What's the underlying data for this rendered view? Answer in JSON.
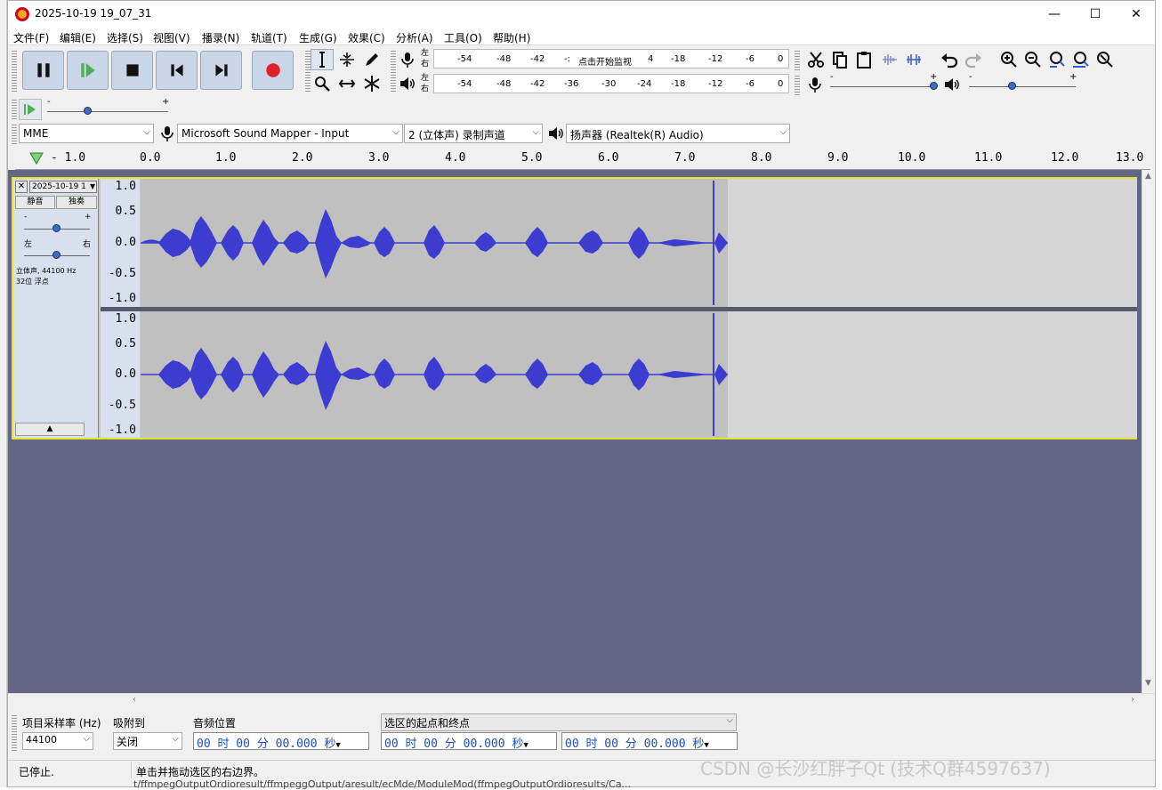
{
  "window": {
    "title": "2025-10-19 19_07_31",
    "minimize_glyph": "—",
    "maximize_glyph": "☐",
    "close_glyph": "✕"
  },
  "menu": [
    "文件(F)",
    "编辑(E)",
    "选择(S)",
    "视图(V)",
    "播录(N)",
    "轨道(T)",
    "生成(G)",
    "效果(C)",
    "分析(A)",
    "工具(O)",
    "帮助(H)"
  ],
  "transport": {
    "buttons": [
      "pause-icon",
      "play-icon",
      "stop-icon",
      "skip-start-icon",
      "skip-end-icon",
      "record-icon"
    ],
    "record_color": "#e0202a"
  },
  "meters": {
    "record_lr": [
      "左",
      "右"
    ],
    "record_ticks": [
      "-54",
      "-48",
      "-42",
      "-:",
      "-18",
      "-12",
      "-6",
      "0"
    ],
    "record_prompt": "点击开始监视",
    "record_prompt_tick": "4",
    "play_lr": [
      "左",
      "右"
    ],
    "play_ticks": [
      "-54",
      "-48",
      "-42",
      "-36",
      "-30",
      "-24",
      "-18",
      "-12",
      "-6",
      "0"
    ]
  },
  "mixer": {
    "minus": "-",
    "plus": "+"
  },
  "playat": {
    "minus": "-",
    "plus": "+"
  },
  "devices": {
    "host": "MME",
    "input_device": "Microsoft Sound Mapper - Input",
    "channels": "2 (立体声) 录制声道",
    "output_device": "扬声器 (Realtek(R) Audio)"
  },
  "ruler": {
    "labels": [
      "- 1.0",
      "0.0",
      "1.0",
      "2.0",
      "3.0",
      "4.0",
      "5.0",
      "6.0",
      "7.0",
      "8.0",
      "9.0",
      "10.0",
      "11.0",
      "12.0",
      "13.0"
    ]
  },
  "track": {
    "name": "2025-10-19 1",
    "mute": "静音",
    "solo": "独奏",
    "gain_minus": "-",
    "gain_plus": "+",
    "pan_left": "左",
    "pan_right": "右",
    "info_line1": "立体声, 44100 Hz",
    "info_line2": "32位 浮点",
    "scale": [
      "1.0",
      "0.5",
      "0.0",
      "-0.5",
      "-1.0"
    ],
    "wave_color": "#3c3cd0",
    "bg_color": "#646686"
  },
  "selection_toolbar": {
    "rate_label": "项目采样率 (Hz)",
    "rate_value": "44100",
    "snap_label": "吸附到",
    "snap_value": "关闭",
    "audio_pos_label": "音频位置",
    "audio_pos_value": "00 时 00 分 00.000 秒",
    "sel_label": "选区的起点和终点",
    "sel_start": "00 时 00 分 00.000 秒",
    "sel_end": "00 时 00 分 00.000 秒"
  },
  "status": {
    "state": "已停止.",
    "hint": "单击并拖动选区的右边界。"
  },
  "watermark": "CSDN @长沙红胖子Qt (技术Q群4597637)",
  "background_text": "t/ffmpegOutputOrdioresult/ffmpeggOutput/aresult/ecMde/ModuleMod(ffmpegOutputOrdioresults/Ca..."
}
